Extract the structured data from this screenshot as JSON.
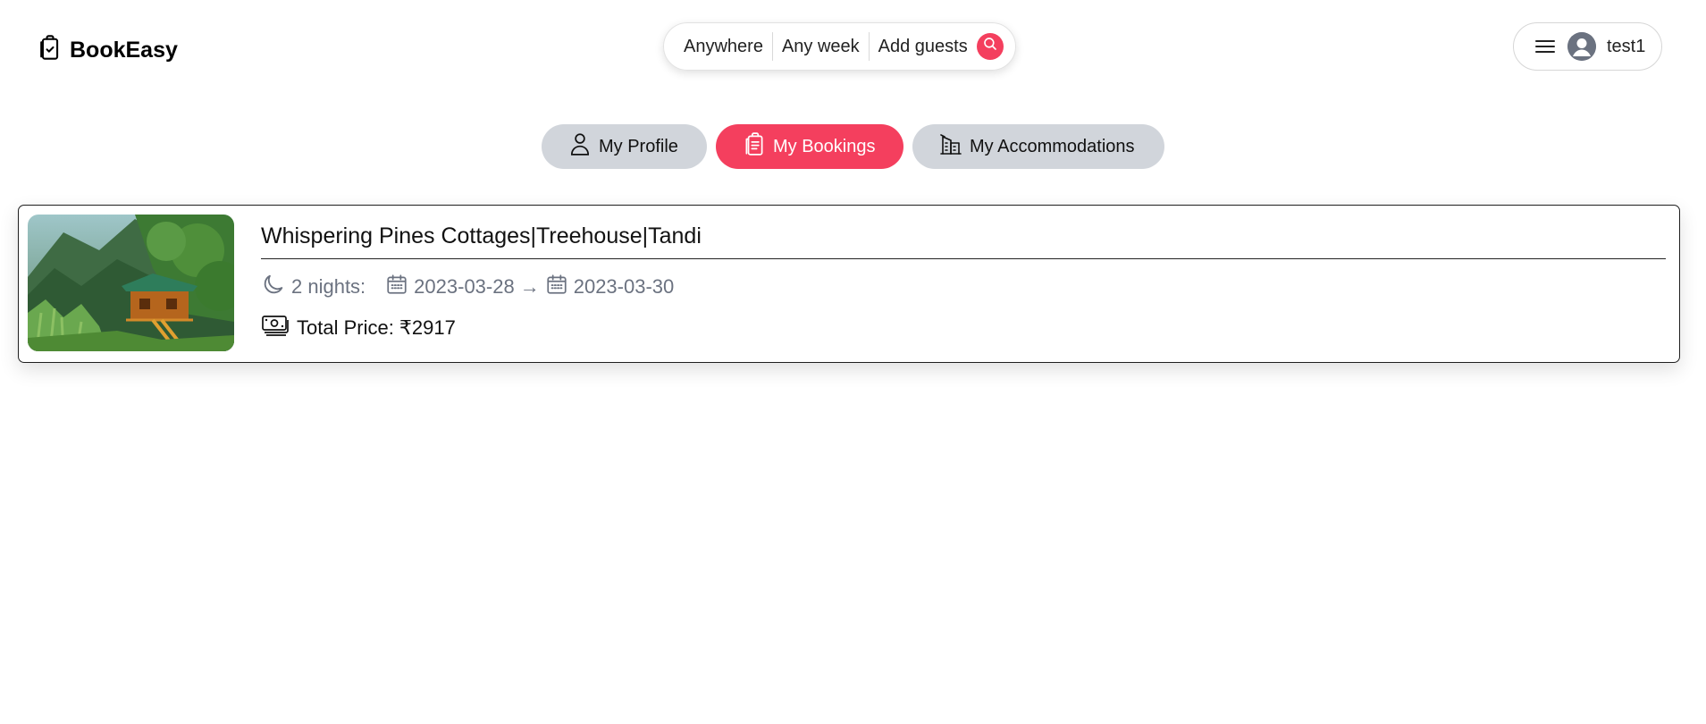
{
  "app": {
    "brand": "BookEasy"
  },
  "search": {
    "where": "Anywhere",
    "when": "Any week",
    "guests": "Add guests"
  },
  "user": {
    "name": "test1"
  },
  "tabs": [
    {
      "label": "My Profile",
      "active": false
    },
    {
      "label": "My Bookings",
      "active": true
    },
    {
      "label": "My Accommodations",
      "active": false
    }
  ],
  "bookings": [
    {
      "title": "Whispering Pines Cottages|Treehouse|Tandi",
      "nights": "2 nights:",
      "check_in": "2023-03-28",
      "arrow": "→",
      "check_out": "2023-03-30",
      "price": "Total Price: ₹2917"
    }
  ],
  "colors": {
    "accent": "#f43f5e",
    "tab_inactive": "#d1d5db",
    "muted_text": "#6b7280"
  }
}
